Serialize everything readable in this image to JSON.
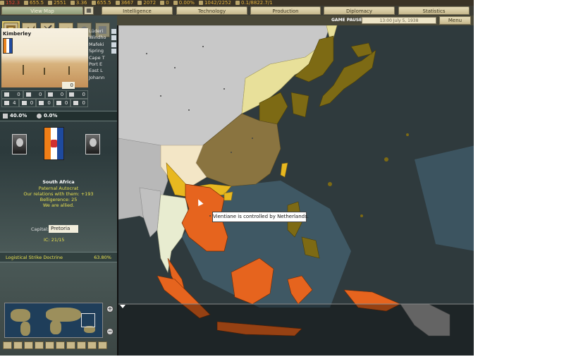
{
  "resources": [
    {
      "icon": "oil-icon",
      "value": "152.3",
      "alert": true
    },
    {
      "icon": "energy-icon",
      "value": "655.5",
      "alert": false
    },
    {
      "icon": "metal-icon",
      "value": "2551",
      "alert": false
    },
    {
      "icon": "rare-materials-icon",
      "value": "3.36",
      "alert": false
    },
    {
      "icon": "supplies-icon",
      "value": "655.5",
      "alert": false
    },
    {
      "icon": "money-icon",
      "value": "3667",
      "alert": false
    },
    {
      "icon": "manpower-icon",
      "value": "2072",
      "alert": false
    },
    {
      "icon": "transport-icon",
      "value": "0",
      "alert": false
    },
    {
      "icon": "dissent-icon",
      "value": "0.00%",
      "alert": false
    },
    {
      "icon": "population-icon",
      "value": "1042/2252",
      "alert": false
    },
    {
      "icon": "production-icon",
      "value": "0.1/8822.7/1",
      "alert": false
    }
  ],
  "tabs": {
    "viewmap": "View Map",
    "intelligence": "Intelligence",
    "technology": "Technology",
    "production": "Production",
    "diplomacy": "Diplomacy",
    "statistics": "Statistics"
  },
  "status": {
    "paused": "GAME PAUSED",
    "date": "13:00 July 5, 1938",
    "menu": "Menu"
  },
  "province": {
    "name": "Kimberley",
    "count": "0",
    "list": [
      "Lüderi",
      "Windho",
      "Mafeki",
      "Spring",
      "Cape T",
      "Port E",
      "East L",
      "Johann"
    ],
    "buildings_row1": [
      "0",
      "0",
      "0",
      "0"
    ],
    "buildings_row2": [
      "4",
      "0",
      "0",
      "0",
      "0"
    ]
  },
  "stats": {
    "infrastructure": "40.0%",
    "ratio": "0.0%"
  },
  "country": {
    "name": "South Africa",
    "government": "Paternal Autocrat",
    "relations": "Our relations with them: +193",
    "belligerence": "Belligerence: 25",
    "allied": "We are allied.",
    "capital_label": "Capital:",
    "capital": "Pretoria",
    "ic": "IC: 21/15"
  },
  "research": {
    "name": "Logistical Strike Doctrine",
    "progress": "63.80%"
  },
  "tooltip": "Vientiane is controlled by Netherlands.",
  "colors": {
    "sea": "#2f3a3d",
    "neutral": "#c8c8c8",
    "japan": "#7d6a14",
    "china": "#8a7440",
    "manchukuo": "#e8e09a",
    "yunnan": "#f3e6c6",
    "siam": "#e8ecd0",
    "netherlands": "#e6641e",
    "accent": "#e8d070"
  }
}
